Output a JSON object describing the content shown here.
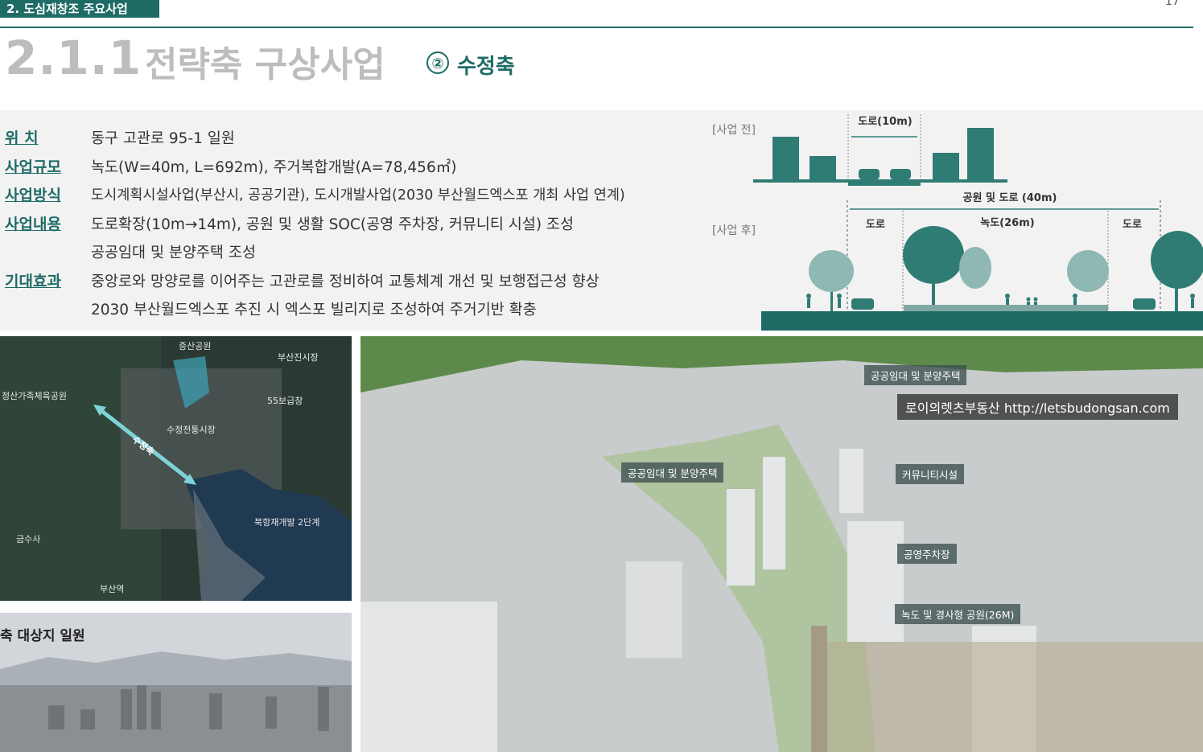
{
  "header": {
    "section_tab": "2. 도심재창조 주요사업",
    "page_number": "17",
    "title_number": "2.1.1",
    "title_text": "전략축 구상사업",
    "subtitle_marker": "②",
    "subtitle": "수정축"
  },
  "info": {
    "location_label": "위   치",
    "location_value": "동구 고관로 95-1 일원",
    "scale_label": "사업규모",
    "scale_value": "녹도(W=40m, L=692m), 주거복합개발(A=78,456㎡)",
    "method_label": "사업방식",
    "method_value": "도시계획시설사업(부산시, 공공기관), 도시개발사업(2030 부산월드엑스포 개최 사업 연계)",
    "content_label": "사업내용",
    "content_value_1": "도로확장(10m→14m), 공원 및 생활 SOC(공영 주차장, 커뮤니티 시설) 조성",
    "content_value_2": "공공임대 및 분양주택 조성",
    "effect_label": "기대효과",
    "effect_value_1": "중앙로와 망양로를 이어주는 고관로를 정비하여 교통체계 개선 및 보행접근성 향상",
    "effect_value_2": "2030 부산월드엑스포 추진 시 엑스포 빌리지로 조성하여 주거기반 확충"
  },
  "diagram": {
    "before_label": "[사업 전]",
    "after_label": "[사업 후]",
    "road_before": "도로(10m)",
    "park_road_total": "공원 및 도로 (40m)",
    "road_left": "도로",
    "green_road": "녹도(26m)",
    "road_right": "도로",
    "teal_color": "#2f7c74"
  },
  "map": {
    "labels": {
      "jeungsan_park": "증산공원",
      "busanjin_market": "부산진시장",
      "jeongsan_gym": "정산가족체육공원",
      "bogeumjang": "55보급창",
      "sujeong_market": "수정전통시장",
      "axis": "수정축",
      "north_port": "북항재개발 2단계",
      "geumsusa": "금수사",
      "busan_station": "부산역"
    }
  },
  "photo": {
    "caption": "축 대상지 일원"
  },
  "render": {
    "label_housing_top": "공공임대 및 분양주택",
    "label_housing_mid": "공공임대 및 분양주택",
    "label_community": "커뮤니티시설",
    "label_parking": "공영주차장",
    "label_greenway": "녹도 및 경사형 공원(26M)",
    "watermark": "로이의렛츠부동산 http://letsbudongsan.com"
  }
}
